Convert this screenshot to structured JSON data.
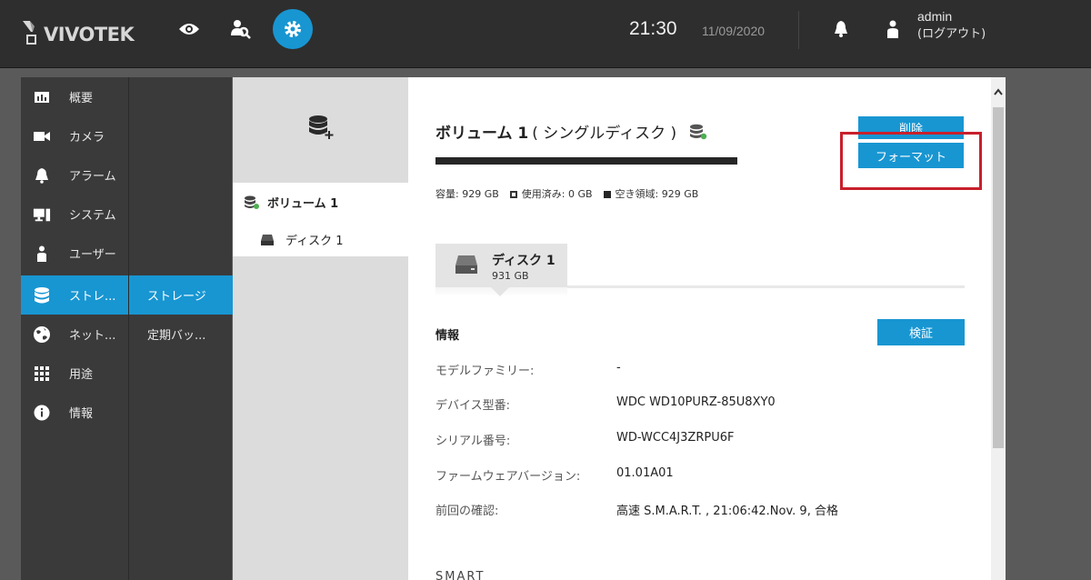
{
  "header": {
    "brand": "VIVOTEK",
    "time": "21:30",
    "date": "11/09/2020",
    "user": "admin",
    "logout": "(ログアウト)",
    "accent_color": "#1896d2",
    "nav": [
      {
        "icon": "eye-icon"
      },
      {
        "icon": "search-person-icon"
      },
      {
        "icon": "gear-icon",
        "active": true
      }
    ]
  },
  "sidebar": {
    "items": [
      {
        "label": "概要",
        "icon": "overview-icon"
      },
      {
        "label": "カメラ",
        "icon": "camera-icon"
      },
      {
        "label": "アラーム",
        "icon": "bell-icon"
      },
      {
        "label": "システム",
        "icon": "computer-icon"
      },
      {
        "label": "ユーザー",
        "icon": "user-icon"
      },
      {
        "label": "ストレ...",
        "icon": "database-icon",
        "active": true
      },
      {
        "label": "ネット...",
        "icon": "globe-icon"
      },
      {
        "label": "用途",
        "icon": "grid-icon"
      },
      {
        "label": "情報",
        "icon": "info-icon"
      }
    ],
    "sub_items": [
      {
        "label": "ストレージ",
        "active": true
      },
      {
        "label": "定期バッ..."
      }
    ]
  },
  "tree": {
    "volume": "ボリューム 1",
    "disk": "ディスク 1"
  },
  "volume": {
    "title": "ボリューム 1",
    "type": "( シングルディスク )",
    "capacity": "容量: 929 GB",
    "used": "使用済み: 0 GB",
    "free": "空き領域: 929 GB",
    "delete_label": "削除",
    "format_label": "フォーマット"
  },
  "disk_tab": {
    "title": "ディスク 1",
    "size": "931 GB"
  },
  "info": {
    "title": "情報",
    "verify_label": "検証",
    "rows": [
      {
        "label": "モデルファミリー:",
        "value": "-"
      },
      {
        "label": "デバイス型番:",
        "value": "WDC WD10PURZ-85U8XY0"
      },
      {
        "label": "シリアル番号:",
        "value": "WD-WCC4J3ZRPU6F"
      },
      {
        "label": "ファームウェアバージョン:",
        "value": "01.01A01"
      },
      {
        "label": "前回の確認:",
        "value": "高速 S.M.A.R.T. , 21:06:42.Nov. 9, 合格"
      }
    ]
  },
  "smart_heading": "SMART"
}
